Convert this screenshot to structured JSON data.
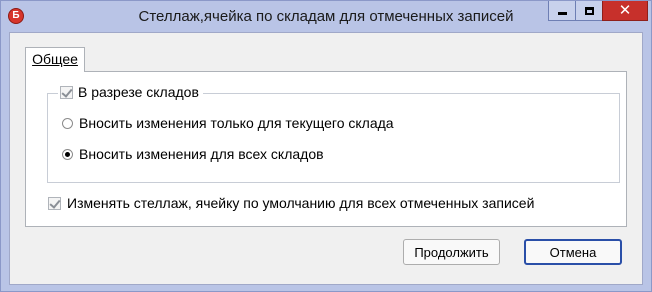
{
  "window": {
    "title": "Стеллаж,ячейка по складам для отмеченных записей",
    "icon_letter": "Б",
    "controls": {
      "minimize": "minimize-icon",
      "maximize": "maximize-icon",
      "close": "✕"
    }
  },
  "tabs": [
    {
      "label": "Общее",
      "selected": true
    }
  ],
  "group": {
    "label": "В разрезе складов",
    "checked": true,
    "options": [
      {
        "label": "Вносить изменения только для текущего склада",
        "selected": false
      },
      {
        "label": "Вносить изменения для всех складов",
        "selected": true
      }
    ]
  },
  "default_checkbox": {
    "label": "Изменять стеллаж, ячейку по умолчанию для всех отмеченных записей",
    "checked": true
  },
  "buttons": {
    "continue": "Продолжить",
    "cancel": "Отмена"
  },
  "colors": {
    "title_bar": "#b9c4e6",
    "close_button": "#c7302b",
    "default_button_border": "#2a4fa8"
  }
}
